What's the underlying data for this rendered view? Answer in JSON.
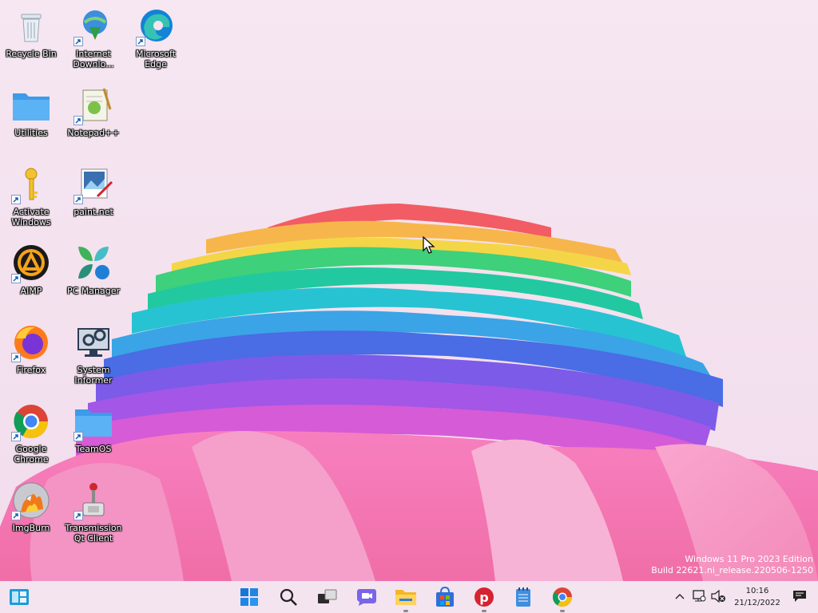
{
  "desktop": {
    "icons": [
      {
        "label": "Recycle Bin"
      },
      {
        "label": "Internet Downlo..."
      },
      {
        "label": "Microsoft Edge"
      },
      {
        "label": "Utilities"
      },
      {
        "label": "Notepad++"
      },
      {
        "label": "Activate Windows"
      },
      {
        "label": "paint.net"
      },
      {
        "label": "AIMP"
      },
      {
        "label": "PC Manager"
      },
      {
        "label": "Firefox"
      },
      {
        "label": "System Informer"
      },
      {
        "label": "Google Chrome"
      },
      {
        "label": "TeamOS"
      },
      {
        "label": "ImgBurn"
      },
      {
        "label": "Transmission Qt Client"
      }
    ]
  },
  "watermark": {
    "line1": "Windows 11 Pro 2023 Edition",
    "line2": "Build 22621.ni_release.220506-1250"
  },
  "taskbar": {
    "left_widget": "widgets-icon",
    "pinned": [
      {
        "icon": "start-icon"
      },
      {
        "icon": "search-icon"
      },
      {
        "icon": "task-view-icon"
      },
      {
        "icon": "chat-icon"
      },
      {
        "icon": "file-explorer-icon"
      },
      {
        "icon": "microsoft-store-icon"
      },
      {
        "icon": "psiphon-icon"
      },
      {
        "icon": "notepad-icon"
      },
      {
        "icon": "chrome-icon"
      }
    ],
    "tray": {
      "icons": [
        "chevron-up-icon",
        "network-icon",
        "volume-muted-icon",
        "notification-icon"
      ],
      "time": "10:16",
      "date": "21/12/2022"
    }
  },
  "colors": {
    "accent": "#0067c0",
    "taskbar_bg": "#f3e4f0"
  }
}
